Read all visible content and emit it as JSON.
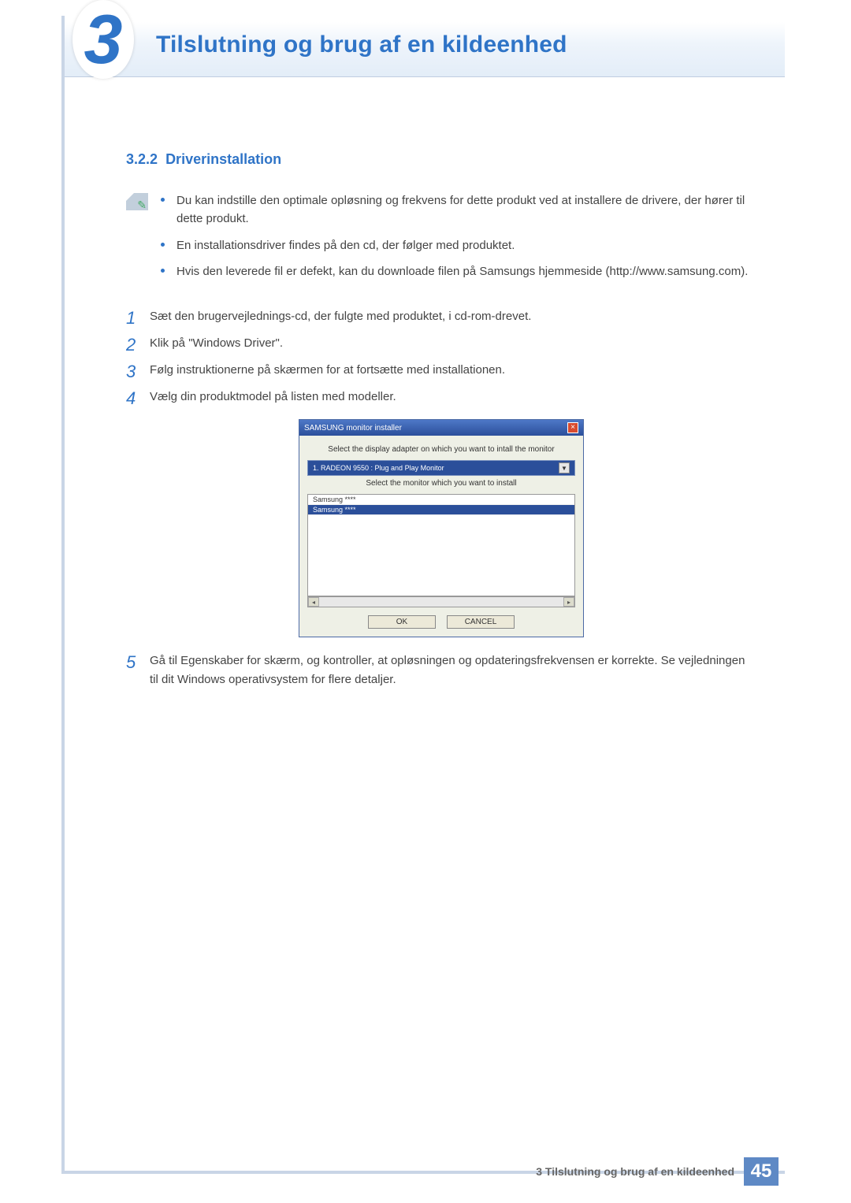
{
  "chapter": {
    "number": "3",
    "title": "Tilslutning og brug af en kildeenhed"
  },
  "section": {
    "number": "3.2.2",
    "title": "Driverinstallation"
  },
  "notes": [
    "Du kan indstille den optimale opløsning og frekvens for dette produkt ved at installere de drivere, der hører til dette produkt.",
    "En installationsdriver findes på den cd, der følger med produktet.",
    "Hvis den leverede fil er defekt, kan du downloade filen på Samsungs hjemmeside (http://www.samsung.com)."
  ],
  "steps": {
    "s1": "Sæt den brugervejlednings-cd, der fulgte med produktet, i cd-rom-drevet.",
    "s2": "Klik på \"Windows Driver\".",
    "s3": "Følg instruktionerne på skærmen for at fortsætte med installationen.",
    "s4": "Vælg din produktmodel på listen med modeller.",
    "s5": "Gå til Egenskaber for skærm, og kontroller, at opløsningen og opdateringsfrekvensen er korrekte. Se vejledningen til dit Windows operativsystem for flere detaljer."
  },
  "step_labels": {
    "n1": "1",
    "n2": "2",
    "n3": "3",
    "n4": "4",
    "n5": "5"
  },
  "dialog": {
    "title": "SAMSUNG monitor installer",
    "text1": "Select the display adapter on which you want to intall the monitor",
    "dropdown_value": "1. RADEON 9550 : Plug and Play Monitor",
    "text2": "Select the monitor which you want to install",
    "list": [
      "Samsung ****",
      "Samsung ****"
    ],
    "ok": "OK",
    "cancel": "CANCEL"
  },
  "footer": {
    "text": "3 Tilslutning og brug af en kildeenhed",
    "page": "45"
  }
}
